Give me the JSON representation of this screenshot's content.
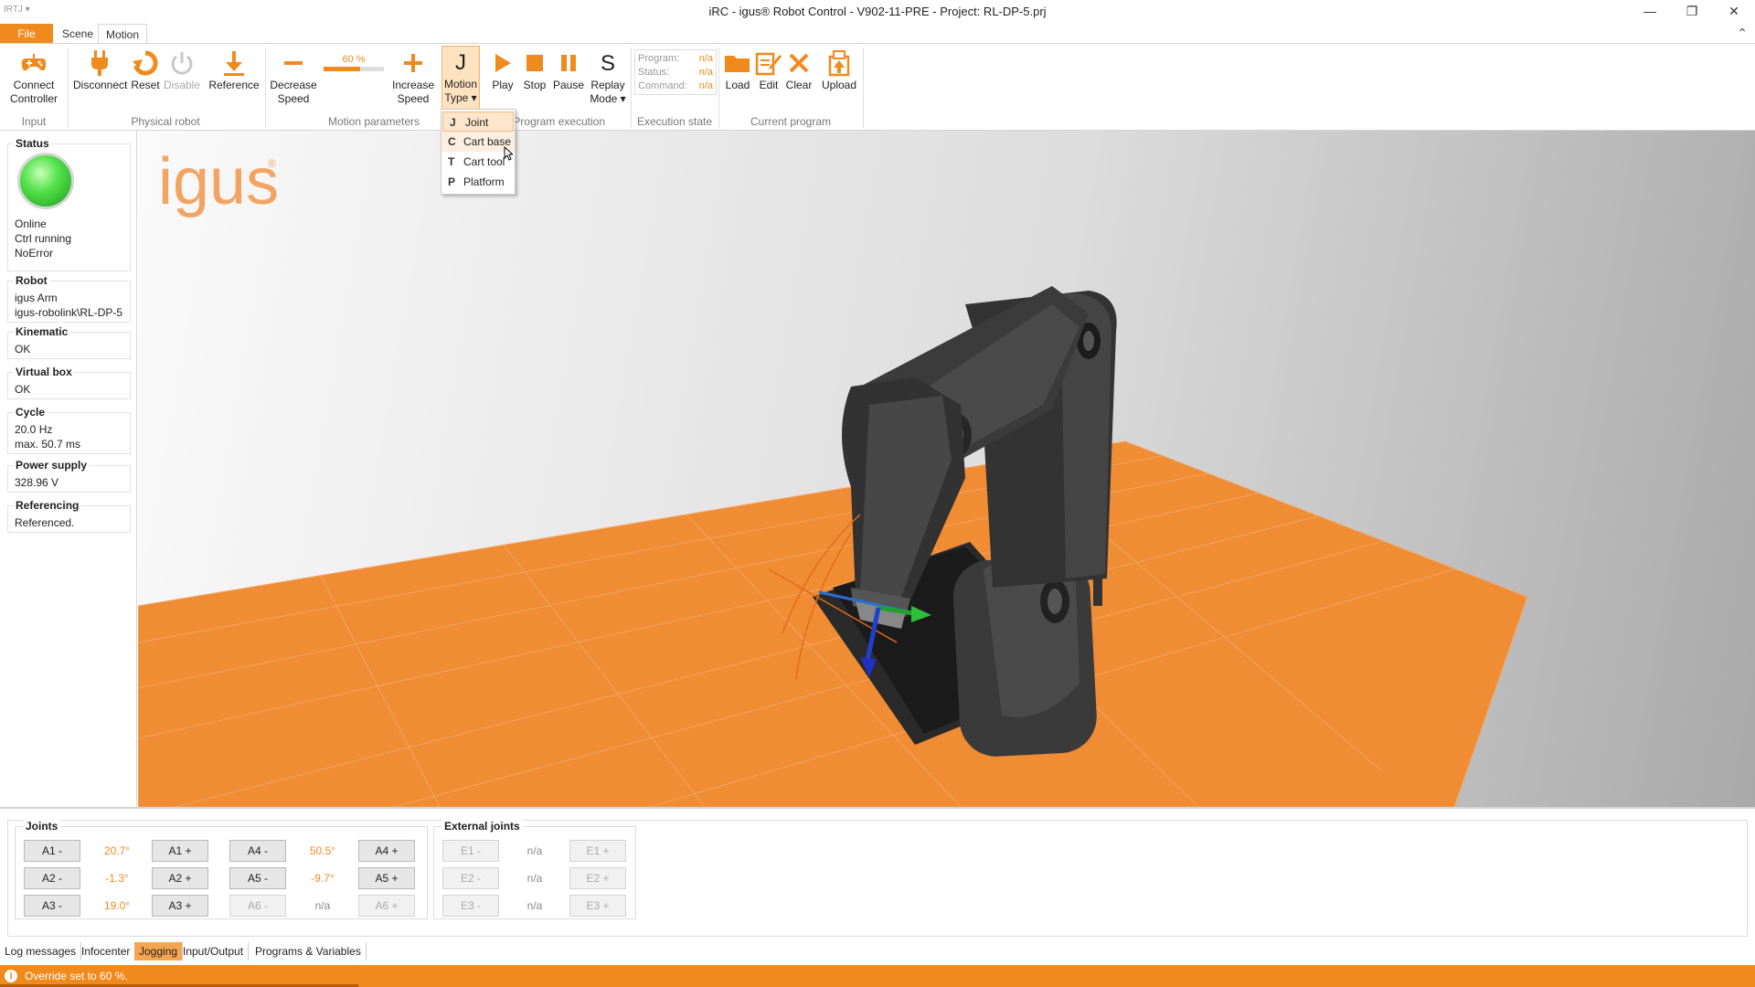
{
  "window": {
    "app_icon": "IRTJ ▾",
    "title": "iRC - igus® Robot Control  -  V902-11-PRE  -  Project: RL-DP-5.prj",
    "minimize": "—",
    "maximize": "❐",
    "close": "✕"
  },
  "ribbon_tabs": {
    "file": "File",
    "scene": "Scene",
    "motion": "Motion",
    "collapse": "⌃"
  },
  "ribbon": {
    "input": {
      "connect": "Connect\nController",
      "group": "Input"
    },
    "physical_robot": {
      "disconnect": "Disconnect",
      "reset": "Reset",
      "disable": "Disable",
      "reference": "Reference",
      "group": "Physical robot"
    },
    "motion_parameters": {
      "decrease": "Decrease\nSpeed",
      "speed_label": "60 %",
      "speed_value": 0.6,
      "increase": "Increase\nSpeed",
      "group": "Motion parameters"
    },
    "motion_type": {
      "letter": "J",
      "label": "Motion\nType ▾"
    },
    "program_execution": {
      "play": "Play",
      "stop": "Stop",
      "pause": "Pause",
      "replay_letter": "S",
      "replay": "Replay\nMode ▾",
      "group": "Program execution"
    },
    "execution_state": {
      "program_label": "Program:",
      "program_value": "n/a",
      "status_label": "Status:",
      "status_value": "n/a",
      "command_label": "Command:",
      "command_value": "n/a",
      "group": "Execution state"
    },
    "current_program": {
      "load": "Load",
      "edit": "Edit",
      "clear": "Clear",
      "upload": "Upload",
      "group": "Current program"
    },
    "colors": {
      "accent": "#f08a1d",
      "accent_light": "#ffe2bf"
    }
  },
  "motion_menu": {
    "items": [
      {
        "key": "J",
        "label": "Joint",
        "checked": true
      },
      {
        "key": "C",
        "label": "Cart base",
        "hover": true
      },
      {
        "key": "T",
        "label": "Cart tool"
      },
      {
        "key": "P",
        "label": "Platform"
      }
    ]
  },
  "status_panel": {
    "status": {
      "title": "Status",
      "line1": "Online",
      "line2": "Ctrl running",
      "line3": "NoError",
      "led_color": "#53e14a"
    },
    "robot": {
      "title": "Robot",
      "line1": "igus Arm",
      "line2": "igus-robolink\\RL-DP-5"
    },
    "kinematic": {
      "title": "Kinematic",
      "value": "OK"
    },
    "virtual_box": {
      "title": "Virtual box",
      "value": "OK"
    },
    "cycle": {
      "title": "Cycle",
      "line1": "20.0 Hz",
      "line2": "max. 50.7 ms"
    },
    "power": {
      "title": "Power supply",
      "value": "328.96 V"
    },
    "referencing": {
      "title": "Referencing",
      "value": "Referenced."
    }
  },
  "viewport": {
    "logo": "igus",
    "logo_mark": "®"
  },
  "jogging": {
    "title": "Joints",
    "rows": [
      {
        "minus": "A1 -",
        "value": "20.7°",
        "plus": "A1 +",
        "minus2": "A4 -",
        "value2": "50.5°",
        "plus2": "A4 +"
      },
      {
        "minus": "A2 -",
        "value": "-1.3°",
        "plus": "A2 +",
        "minus2": "A5 -",
        "value2": "-9.7°",
        "plus2": "A5 +"
      },
      {
        "minus": "A3 -",
        "value": "19.0°",
        "plus": "A3 +",
        "minus2": "A6 -",
        "value2": "n/a",
        "plus2": "A6 +"
      }
    ],
    "external_title": "External joints",
    "external": [
      {
        "minus": "E1 -",
        "value": "n/a",
        "plus": "E1 +"
      },
      {
        "minus": "E2 -",
        "value": "n/a",
        "plus": "E2 +"
      },
      {
        "minus": "E3 -",
        "value": "n/a",
        "plus": "E3 +"
      }
    ]
  },
  "bottom_tabs": [
    "Log messages",
    "Infocenter",
    "Jogging",
    "Input/Output",
    "Programs & Variables"
  ],
  "active_bottom_tab": "Jogging",
  "statusbar": {
    "icon": "i",
    "message": "Override set to 60 %."
  }
}
